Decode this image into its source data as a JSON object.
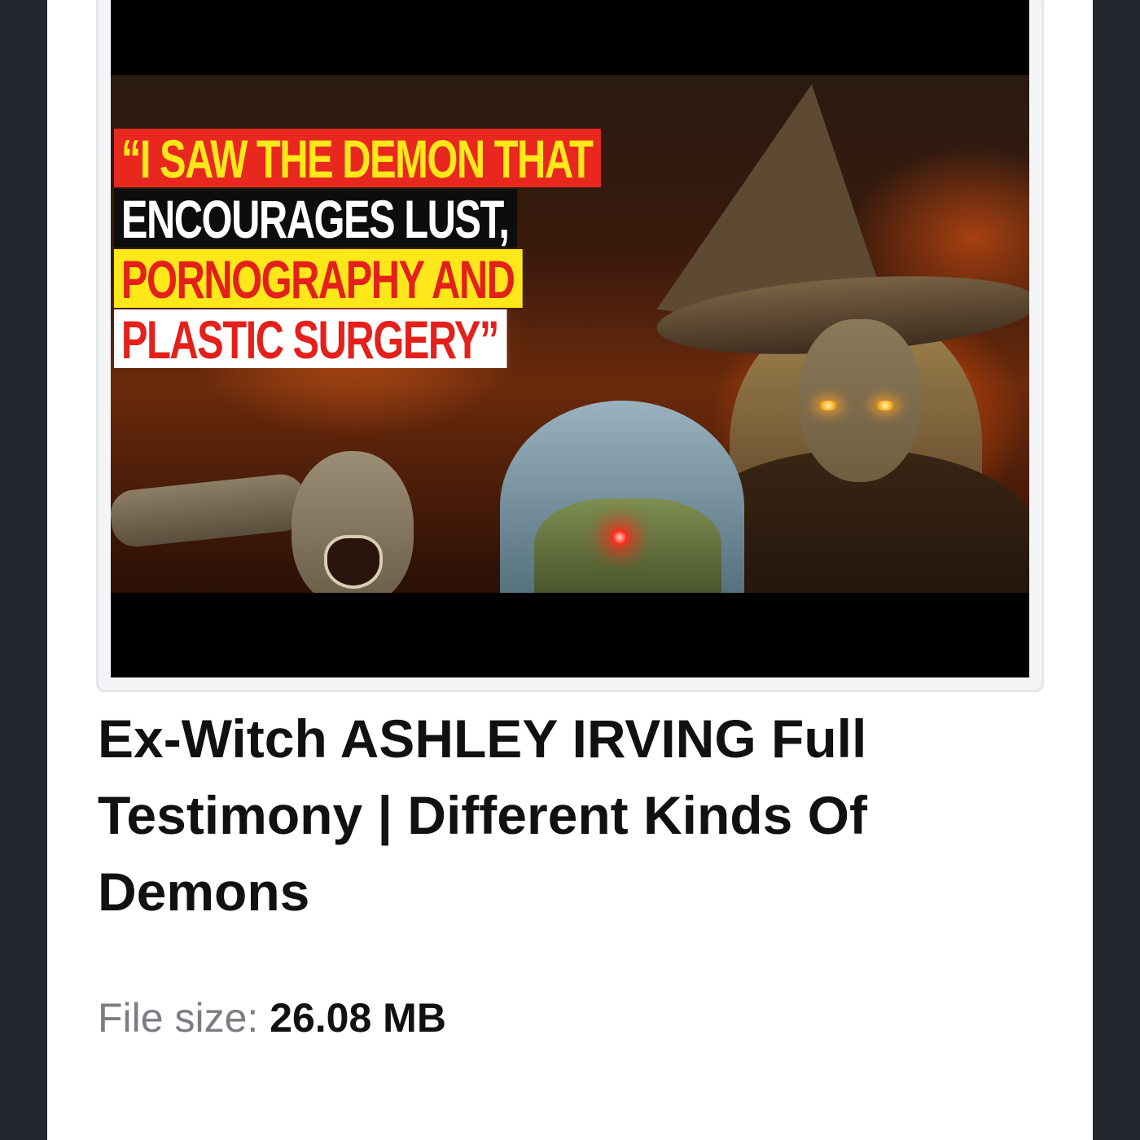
{
  "video": {
    "thumbnail": {
      "headline_lines": [
        "“I SAW THE DEMON THAT",
        "ENCOURAGES LUST,",
        "PORNOGRAPHY AND",
        "PLASTIC SURGERY”"
      ]
    },
    "title": "Ex-Witch ASHLEY IRVING Full Testimony | Different Kinds Of Demons",
    "file_size": {
      "label": "File size:",
      "value": "26.08 MB"
    }
  },
  "colors": {
    "background_dark": "#24282e",
    "card": "#ffffff",
    "headline_red": "#e8281e",
    "headline_yellow": "#ffe81a",
    "text_primary": "#111111",
    "text_muted": "#7a7d82"
  }
}
